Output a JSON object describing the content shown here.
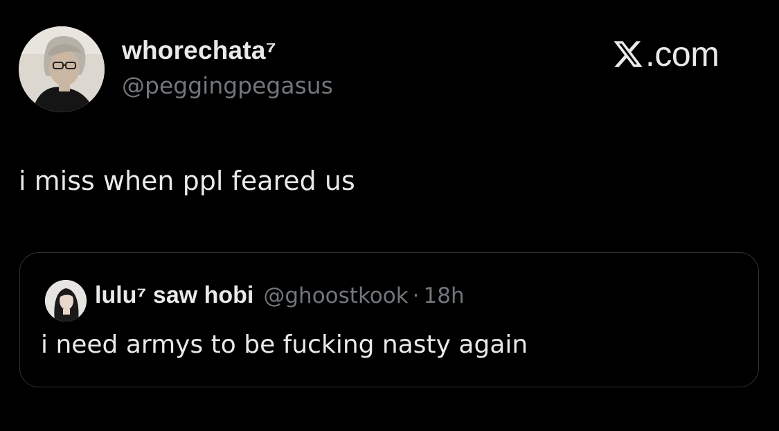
{
  "tweet": {
    "author": {
      "display_name": "whorechata⁷",
      "handle": "@peggingpegasus"
    },
    "text": "i miss when ppl feared us"
  },
  "brand": {
    "icon": "x-logo-icon",
    "text": ".com"
  },
  "quoted_tweet": {
    "display_name": "lulu⁷ saw hobi",
    "handle": "@ghoostkook",
    "separator": "·",
    "time": "18h",
    "text": "i need armys to be fucking nasty again"
  },
  "colors": {
    "background": "#000000",
    "primary_text": "#e7e9ea",
    "secondary_text": "#71767b",
    "border": "#2f3336"
  }
}
